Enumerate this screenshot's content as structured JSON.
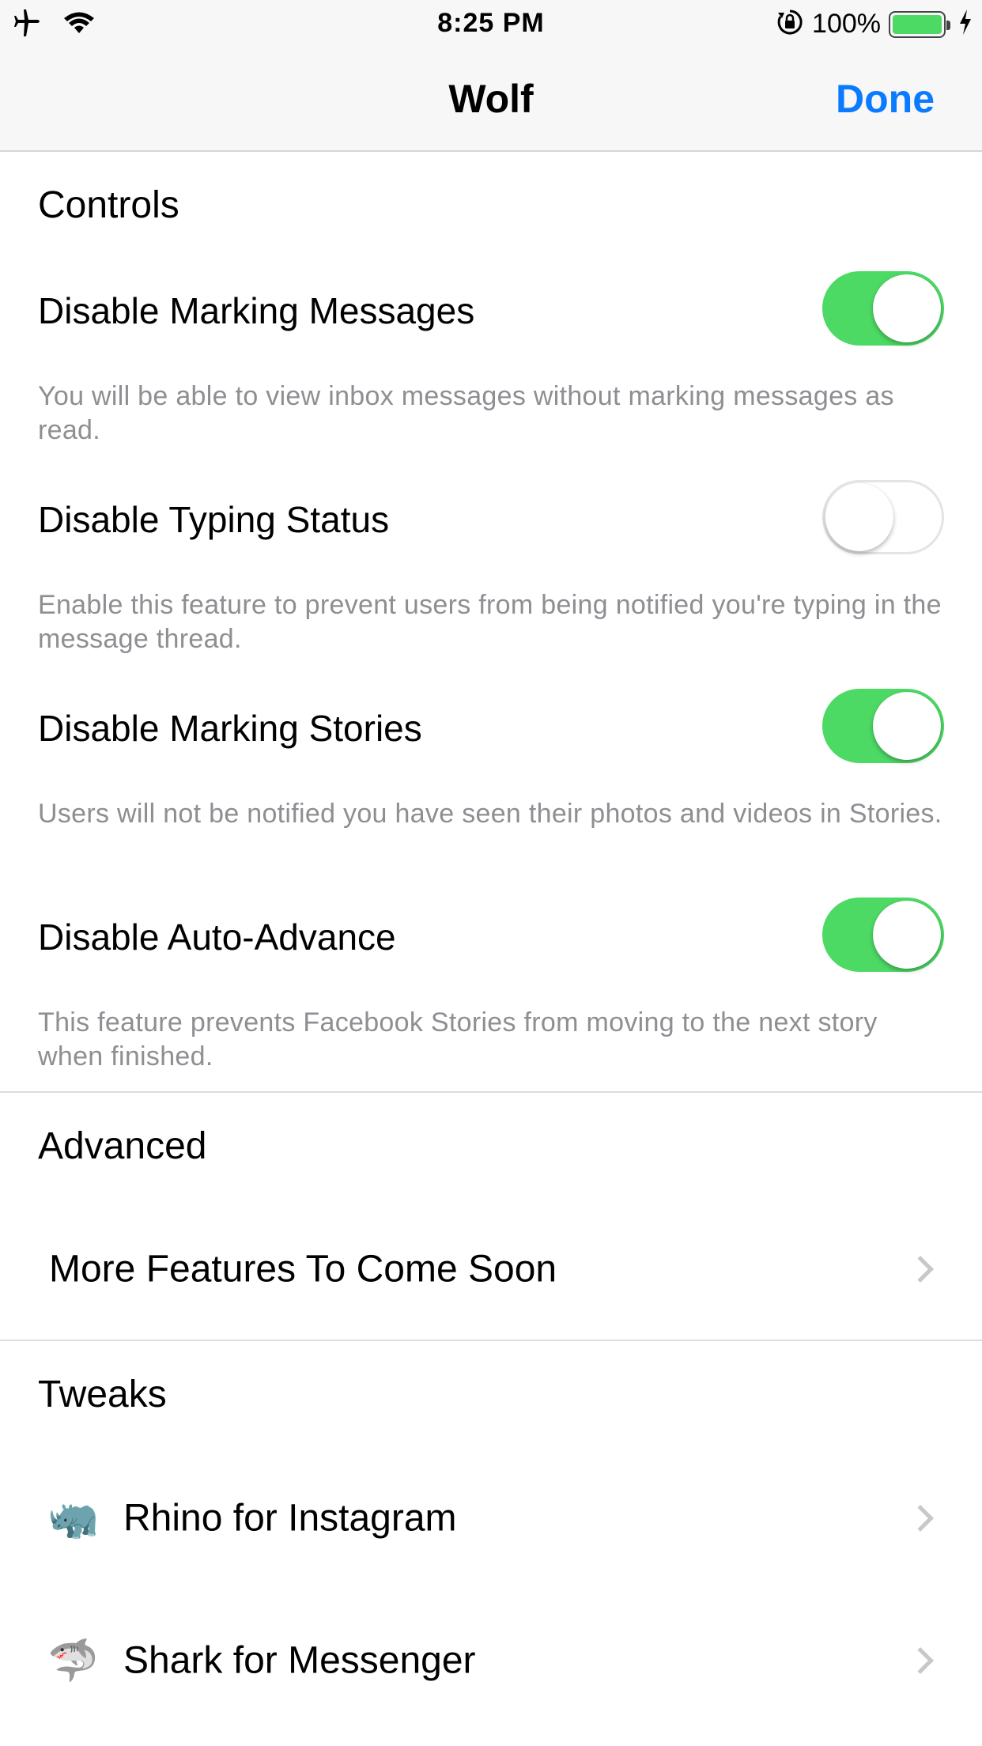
{
  "status_bar": {
    "time": "8:25 PM",
    "battery_percent": "100%",
    "battery_level": 1.0,
    "icons": [
      "airplane-icon",
      "wifi-icon",
      "orientation-lock-icon",
      "battery-icon",
      "charging-bolt-icon"
    ]
  },
  "nav": {
    "title": "Wolf",
    "done_label": "Done",
    "accent_color": "#0a7aff"
  },
  "sections": {
    "controls": {
      "header": "Controls",
      "items": [
        {
          "label": "Disable Marking Messages",
          "description": "You will be able to view inbox messages without marking messages as read.",
          "enabled": true
        },
        {
          "label": "Disable Typing Status",
          "description": "Enable this feature to prevent users from being notified you're typing in the message thread.",
          "enabled": false
        },
        {
          "label": "Disable Marking Stories",
          "description": "Users will not be notified you have seen their photos and videos in Stories.",
          "enabled": true
        },
        {
          "label": "Disable Auto-Advance",
          "description": "This feature prevents Facebook Stories from moving to the next story when finished.",
          "enabled": true
        }
      ]
    },
    "advanced": {
      "header": "Advanced",
      "items": [
        {
          "label": "More Features To Come Soon"
        }
      ]
    },
    "tweaks": {
      "header": "Tweaks",
      "items": [
        {
          "icon": "🦏",
          "icon_name": "rhino-icon",
          "label": "Rhino for Instagram"
        },
        {
          "icon": "🦈",
          "icon_name": "shark-icon",
          "label": "Shark for Messenger"
        }
      ]
    }
  },
  "colors": {
    "toggle_on": "#4cd964",
    "description_text": "#8e8e93"
  }
}
